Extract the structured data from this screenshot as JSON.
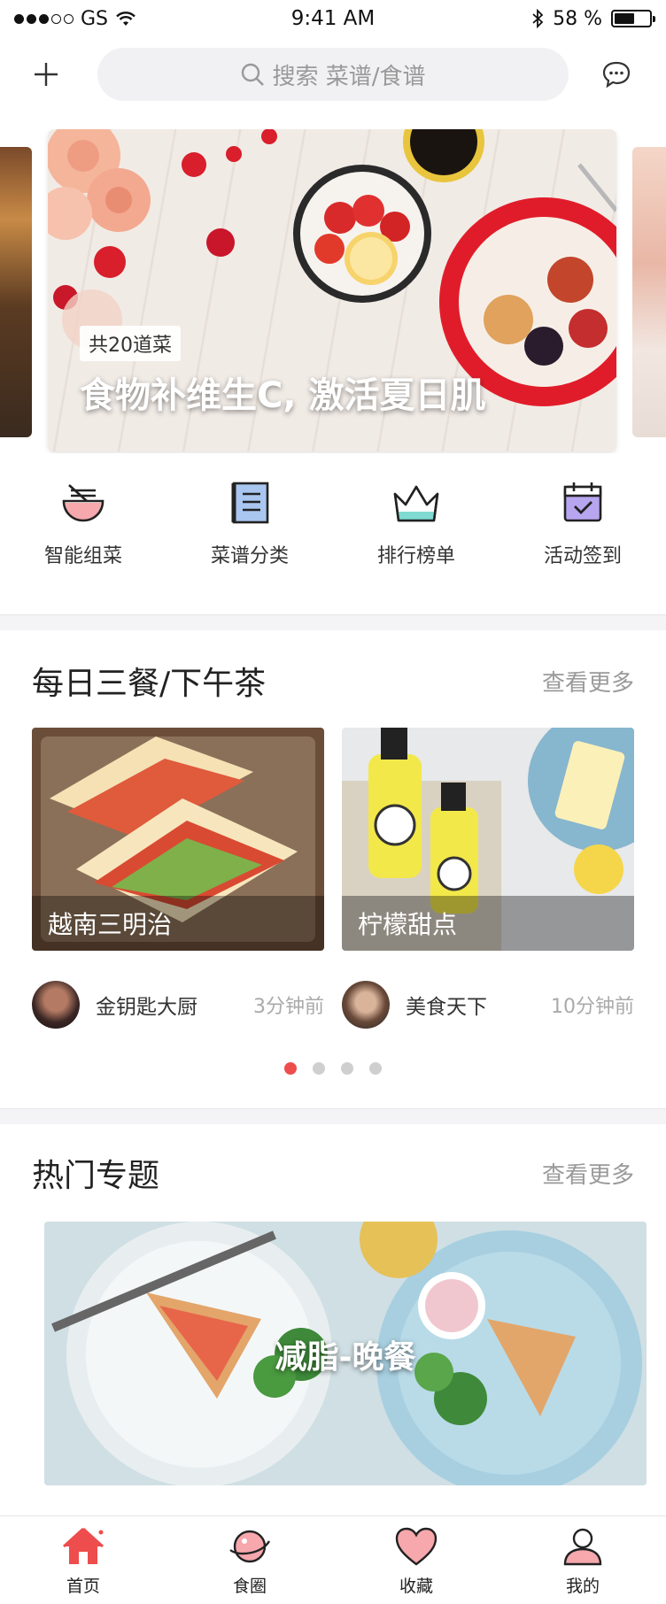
{
  "status_bar": {
    "carrier": "GS",
    "time": "9:41 AM",
    "battery_text": "58 %",
    "battery_level": 0.58
  },
  "search": {
    "placeholder": "搜索 菜谱/食谱"
  },
  "banner": {
    "tag": "共20道菜",
    "title": "食物补维生C, 激活夏日肌"
  },
  "quick_actions": [
    {
      "label": "智能组菜",
      "icon": "bowl-icon"
    },
    {
      "label": "菜谱分类",
      "icon": "recipe-book-icon"
    },
    {
      "label": "排行榜单",
      "icon": "crown-icon"
    },
    {
      "label": "活动签到",
      "icon": "calendar-check-icon"
    }
  ],
  "meals": {
    "title": "每日三餐/下午茶",
    "more": "查看更多",
    "cards": [
      {
        "caption": "越南三明治",
        "author": "金钥匙大厨",
        "time": "3分钟前"
      },
      {
        "caption": "柠檬甜点",
        "author": "美食天下",
        "time": "10分钟前"
      }
    ],
    "pager": {
      "count": 4,
      "active": 0
    }
  },
  "topics": {
    "title": "热门专题",
    "more": "查看更多",
    "card_title": "减脂-晚餐"
  },
  "tabbar": [
    {
      "label": "首页",
      "icon": "home-icon",
      "active": true
    },
    {
      "label": "食圈",
      "icon": "planet-icon",
      "active": false
    },
    {
      "label": "收藏",
      "icon": "heart-icon",
      "active": false
    },
    {
      "label": "我的",
      "icon": "user-icon",
      "active": false
    }
  ],
  "colors": {
    "accent": "#ee4d4d",
    "pink": "#f6a8ad",
    "teal": "#7fdad2",
    "purple": "#b7a6ef",
    "blue": "#a9c6f0"
  }
}
